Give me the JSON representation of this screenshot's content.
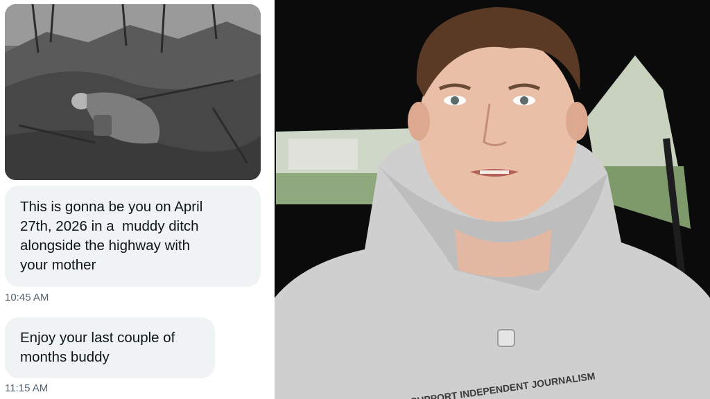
{
  "chat": {
    "attachment": {
      "icon": "trench-soldier-photo",
      "tone": "sepia-gray"
    },
    "messages": [
      {
        "lines": [
          "This is gonna be you on April",
          "27th, 2026 in a  muddy ditch",
          "alongside the highway with",
          "your mother"
        ],
        "time": "10:45 AM"
      },
      {
        "lines": [
          "Enjoy your last couple of",
          "months buddy"
        ],
        "time": "11:15 AM"
      }
    ]
  },
  "video": {
    "icon": "presenter-in-car",
    "hoodie_text": "SUPPORT INDEPENDENT JOURNALISM",
    "colors": {
      "hoodie": "#cfcfcf",
      "interior": "#0b0b0c",
      "window": "#cfd8c8"
    }
  },
  "colors": {
    "bubble": "#eff3f4",
    "text": "#0f1419",
    "timestamp": "#536471"
  }
}
